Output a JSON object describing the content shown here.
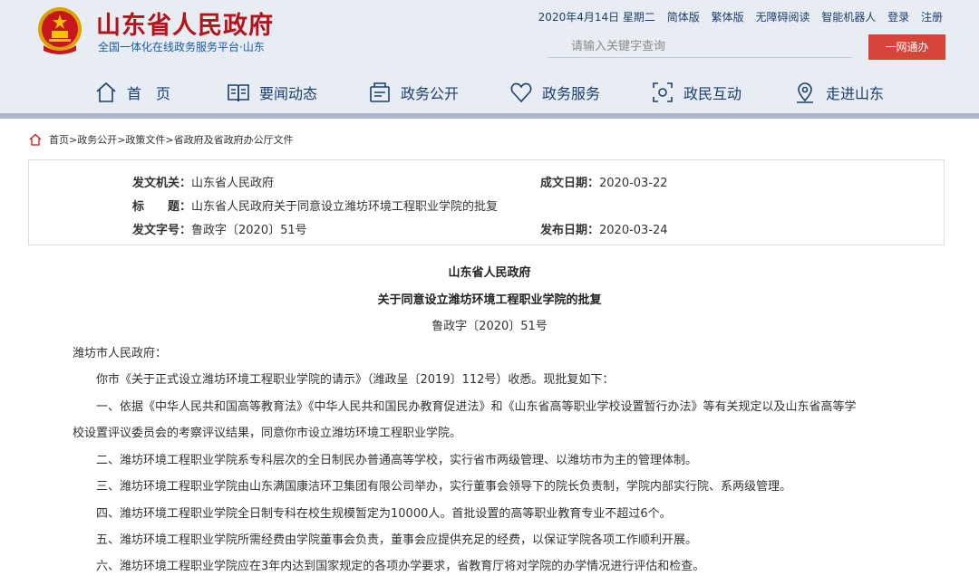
{
  "header": {
    "site_title": "山东省人民政府",
    "site_subtitle": "全国一体化在线政务服务平台·山东",
    "date": "2020年4月14日 星期二",
    "links": [
      "简体版",
      "繁体版",
      "无障碍阅读",
      "智能机器人",
      "登录",
      "注册"
    ],
    "search_placeholder": "请输入关键字查询",
    "one_net_button": "一网通办"
  },
  "nav": {
    "items": [
      "首　页",
      "要闻动态",
      "政务公开",
      "政务服务",
      "政民互动",
      "走进山东"
    ]
  },
  "breadcrumb": "首页>政务公开>政策文件>省政府及省政府办公厅文件",
  "info": {
    "issuer_label": "发文机关：",
    "issuer": "山东省人民政府",
    "title_label": "标　　题：",
    "title": "山东省人民政府关于同意设立潍坊环境工程职业学院的批复",
    "doc_no_label": "发文字号：",
    "doc_no": "鲁政字〔2020〕51号",
    "created_label": "成文日期：",
    "created": "2020-03-22",
    "published_label": "发布日期：",
    "published": "2020-03-24"
  },
  "document": {
    "heading1": "山东省人民政府",
    "heading2": "关于同意设立潍坊环境工程职业学院的批复",
    "number": "鲁政字〔2020〕51号",
    "paragraphs": [
      "潍坊市人民政府：",
      "　　你市《关于正式设立潍坊环境工程职业学院的请示》（潍政呈〔2019〕112号）收悉。现批复如下：",
      "　　一、依据《中华人民共和国高等教育法》《中华人民共和国民办教育促进法》和《山东省高等职业学校设置暂行办法》等有关规定以及山东省高等学",
      "校设置评议委员会的考察评议结果，同意你市设立潍坊环境工程职业学院。",
      "　　二、潍坊环境工程职业学院系专科层次的全日制民办普通高等学校，实行省市两级管理、以潍坊市为主的管理体制。",
      "　　三、潍坊环境工程职业学院由山东满国康洁环卫集团有限公司举办，实行董事会领导下的院长负责制，学院内部实行院、系两级管理。",
      "　　四、潍坊环境工程职业学院全日制专科在校生规模暂定为10000人。首批设置的高等职业教育专业不超过6个。",
      "　　五、潍坊环境工程职业学院所需经费由学院董事会负责，董事会应提供充足的经费，以保证学院各项工作顺利开展。",
      "　　六、潍坊环境工程职业学院应在3年内达到国家规定的各项办学要求，省教育厅将对学院的办学情况进行评估和检查。"
    ]
  },
  "colors": {
    "title_red": "#b5121b",
    "nav_blue": "#1a3e70",
    "button_red": "#d6443a",
    "header_bg": "#e8edf3"
  }
}
